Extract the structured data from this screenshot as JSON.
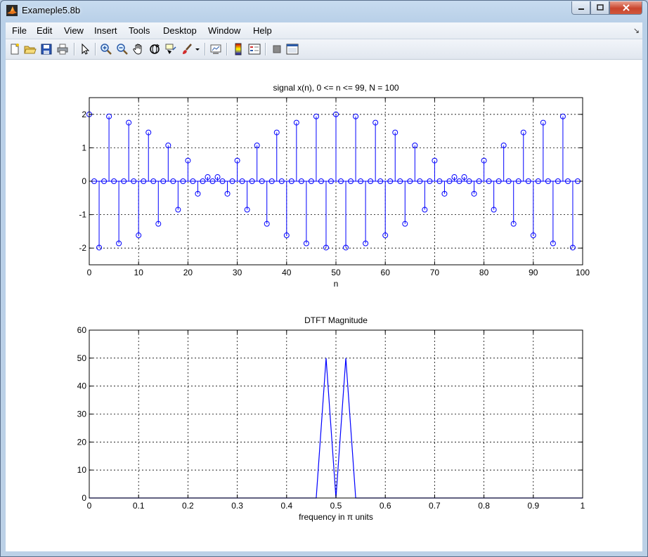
{
  "window": {
    "title": "Exameple5.8b"
  },
  "menu": {
    "items": [
      "File",
      "Edit",
      "View",
      "Insert",
      "Tools",
      "Desktop",
      "Window",
      "Help"
    ],
    "corner_glyph": "↘"
  },
  "toolbar": {
    "icons": [
      "new-figure-icon",
      "open-file-icon",
      "save-icon",
      "print-icon",
      "select-arrow-icon",
      "zoom-in-icon",
      "zoom-out-icon",
      "pan-hand-icon",
      "rotate-3d-icon",
      "data-cursor-icon",
      "brush-icon",
      "dropdown-arrow-icon",
      "link-plot-icon",
      "colorbar-icon",
      "legend-icon",
      "hide-plot-tools-icon",
      "show-plot-tools-icon"
    ]
  },
  "colors": {
    "plot_blue": "#0000ff",
    "window_frame": "#b9d0e8"
  },
  "chart_data": [
    {
      "type": "stem",
      "title": "signal x(n), 0 <= n <= 99, N = 100",
      "xlabel": "n",
      "ylabel": "",
      "xlim": [
        0,
        100
      ],
      "ylim": [
        -2.5,
        2.5
      ],
      "xticks": [
        0,
        10,
        20,
        30,
        40,
        50,
        60,
        70,
        80,
        90,
        100
      ],
      "yticks": [
        -2,
        -1,
        0,
        1,
        2
      ],
      "grid": true,
      "formula": "x(n) = cos(0.48*pi*n) + cos(0.52*pi*n), n = 0..99"
    },
    {
      "type": "line",
      "title": "DTFT Magnitude",
      "xlabel": "frequency in π units",
      "ylabel": "",
      "xlim": [
        0,
        1
      ],
      "ylim": [
        0,
        60
      ],
      "xticks": [
        0,
        0.1,
        0.2,
        0.3,
        0.4,
        0.5,
        0.6,
        0.7,
        0.8,
        0.9,
        1
      ],
      "yticks": [
        0,
        10,
        20,
        30,
        40,
        50,
        60
      ],
      "grid": true,
      "x": [
        0,
        0.46,
        0.48,
        0.5,
        0.52,
        0.54,
        1.0
      ],
      "y": [
        0,
        0,
        50,
        0,
        50,
        0,
        0
      ]
    }
  ]
}
